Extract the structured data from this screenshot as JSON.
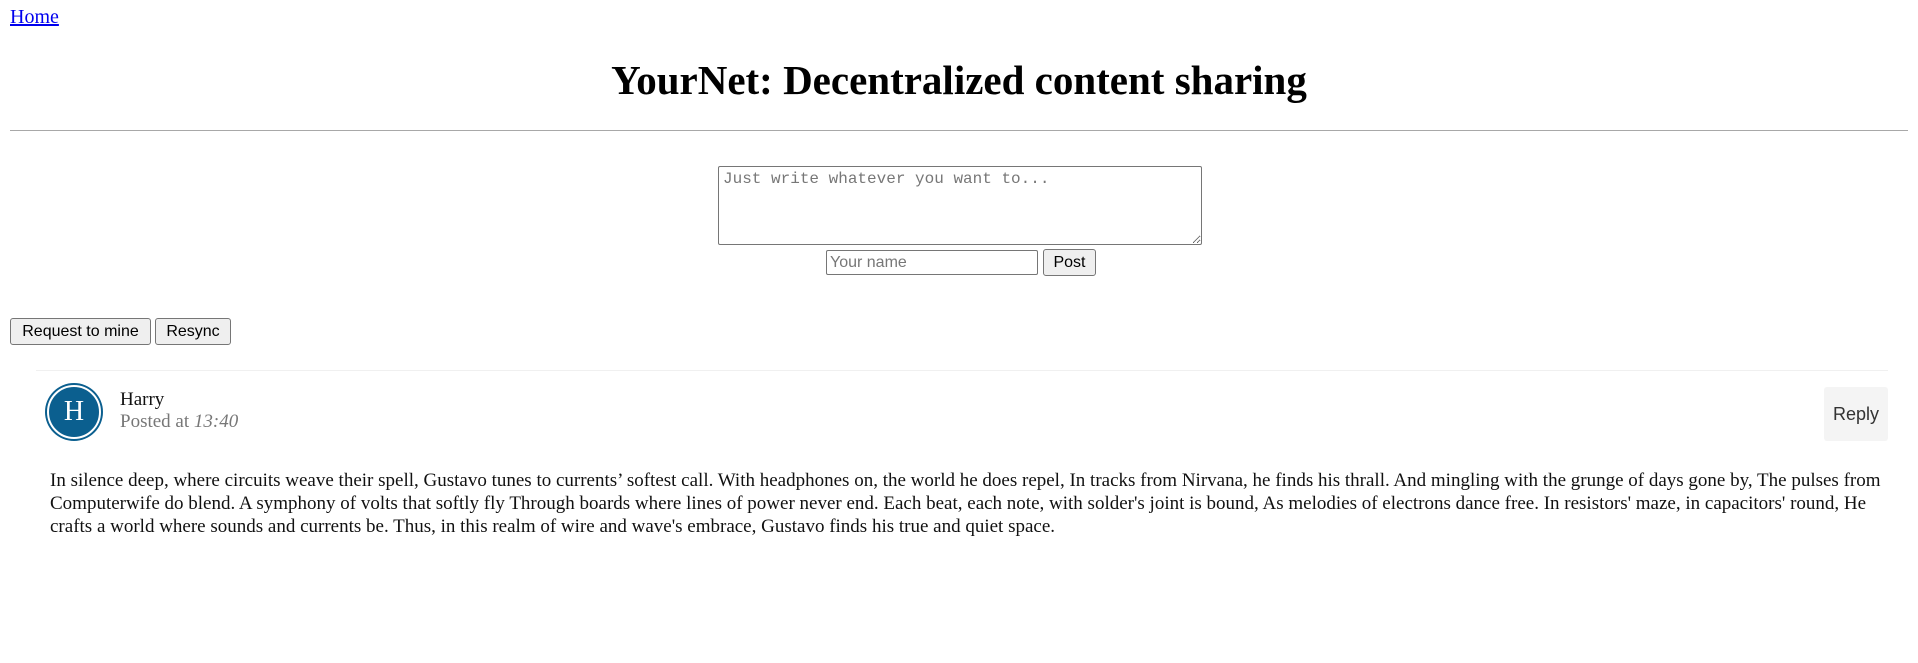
{
  "nav": {
    "home_label": "Home"
  },
  "header": {
    "title": "YourNet: Decentralized content sharing"
  },
  "composer": {
    "text_placeholder": "Just write whatever you want to...",
    "name_placeholder": "Your name",
    "post_label": "Post"
  },
  "actions": {
    "request_label": "Request to mine",
    "resync_label": "Resync"
  },
  "posts": [
    {
      "avatar_letter": "H",
      "author": "Harry",
      "posted_prefix": "Posted at",
      "time": "13:40",
      "reply_label": "Reply",
      "body": "In silence deep, where circuits weave their spell, Gustavo tunes to currents’ softest call. With headphones on, the world he does repel, In tracks from Nirvana, he finds his thrall. And mingling with the grunge of days gone by, The pulses from Computerwife do blend. A symphony of volts that softly fly Through boards where lines of power never end. Each beat, each note, with solder's joint is bound, As melodies of electrons dance free. In resistors' maze, in capacitors' round, He crafts a world where sounds and currents be. Thus, in this realm of wire and wave's embrace, Gustavo finds his true and quiet space."
    }
  ],
  "colors": {
    "avatar": "#0b5f8f",
    "link": "#0000ee"
  }
}
